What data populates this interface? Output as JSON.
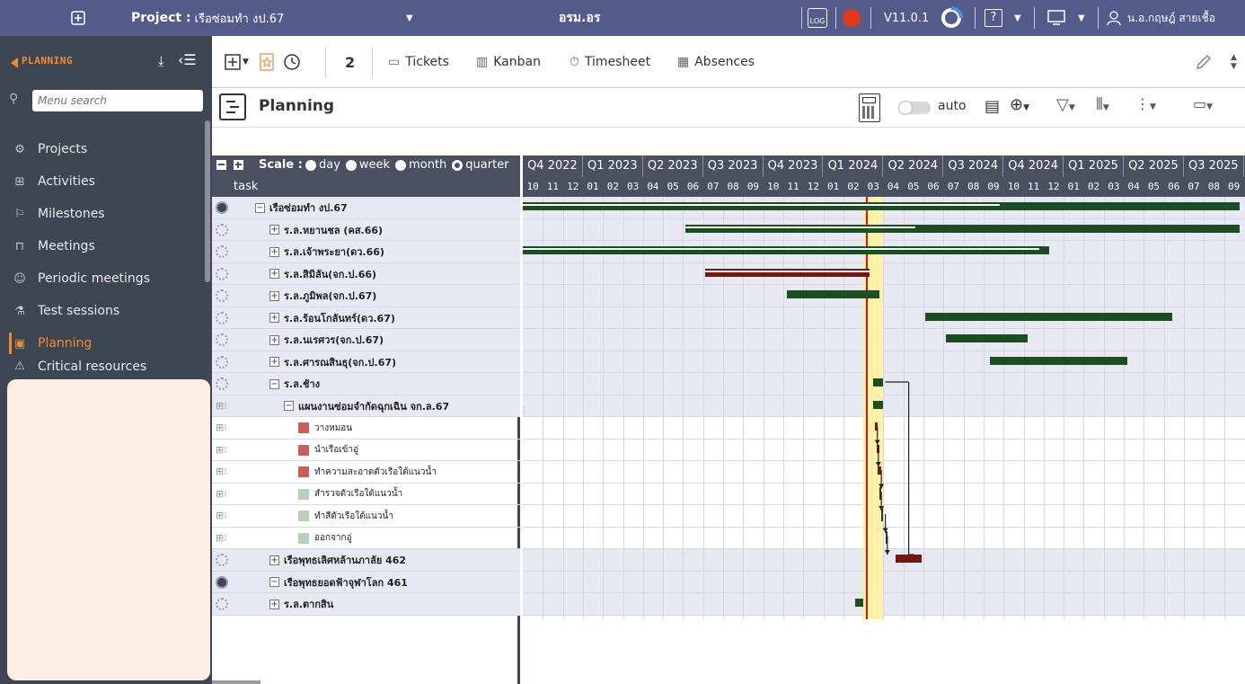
{
  "topbar": {
    "project_label": "Project :",
    "project_value": "เรือซ่อมทำ งป.67",
    "org": "อรม.อร",
    "log_label": "LOG",
    "version": "V11.0.1",
    "help_label": "?",
    "user": "น.อ.กฤษฎ์ สายเชื้อ"
  },
  "sidebar": {
    "title": "PLANNING",
    "search_placeholder": "Menu search",
    "items": [
      {
        "label": "Projects",
        "icon": "gear-icon"
      },
      {
        "label": "Activities",
        "icon": "hierarchy-icon"
      },
      {
        "label": "Milestones",
        "icon": "flag-icon"
      },
      {
        "label": "Meetings",
        "icon": "meeting-icon"
      },
      {
        "label": "Periodic meetings",
        "icon": "group-icon"
      },
      {
        "label": "Test sessions",
        "icon": "flask-icon"
      },
      {
        "label": "Planning",
        "icon": "planning-icon",
        "active": true
      },
      {
        "label": "Critical resources",
        "icon": "warning-icon"
      }
    ]
  },
  "toolbar": {
    "count": "2",
    "tickets": "Tickets",
    "kanban": "Kanban",
    "timesheet": "Timesheet",
    "absences": "Absences"
  },
  "planning": {
    "title": "Planning",
    "auto_label": "auto",
    "scale_label": "Scale :",
    "scale_options": [
      "day",
      "week",
      "month",
      "quarter"
    ],
    "scale_selected": "quarter",
    "task_header": "task"
  },
  "quarters": [
    "Q4 2022",
    "Q1 2023",
    "Q2 2023",
    "Q3 2023",
    "Q4 2023",
    "Q1 2024",
    "Q2 2024",
    "Q3 2024",
    "Q4 2024",
    "Q1 2025",
    "Q2 2025",
    "Q3 2025"
  ],
  "months": [
    "10",
    "11",
    "12",
    "01",
    "02",
    "03",
    "04",
    "05",
    "06",
    "07",
    "08",
    "09",
    "10",
    "11",
    "12",
    "01",
    "02",
    "03",
    "04",
    "05",
    "06",
    "07",
    "08",
    "09",
    "10",
    "11",
    "12",
    "01",
    "02",
    "03",
    "04",
    "05",
    "06",
    "07",
    "08",
    "09"
  ],
  "today_month_index": 17,
  "tasks": [
    {
      "name": "เรือซ่อมทำ งป.67",
      "level": 0,
      "exp": "−",
      "kind": "gear-sel",
      "grey": true,
      "bar": {
        "type": "g",
        "start": 0,
        "end": 35.8,
        "done": 23.8
      }
    },
    {
      "name": "ร.ล.หยานชล (คส.66)",
      "level": 1,
      "exp": "+",
      "kind": "gear",
      "grey": true,
      "bar": {
        "type": "g",
        "start": 8.1,
        "end": 35.8,
        "done": 19.6
      }
    },
    {
      "name": "ร.ล.เจ้าพระยา(ดว.66)",
      "level": 1,
      "exp": "+",
      "kind": "gear",
      "grey": true,
      "bar": {
        "type": "g",
        "start": 0,
        "end": 26.3,
        "done": 25.8
      }
    },
    {
      "name": "ร.ล.สิมิลัน(จก.ป.66)",
      "level": 1,
      "exp": "+",
      "kind": "gear",
      "grey": true,
      "bar": {
        "type": "r",
        "start": 9.1,
        "end": 17.3,
        "done": 17.3
      }
    },
    {
      "name": "ร.ล.ภูมิพล(จก.ป.67)",
      "level": 1,
      "exp": "+",
      "kind": "gear",
      "grey": true,
      "bar": {
        "type": "g",
        "start": 13.2,
        "end": 17.8,
        "done": 0
      }
    },
    {
      "name": "ร.ล.ร้อนโกลันทร์(ดว.67)",
      "level": 1,
      "exp": "+",
      "kind": "gear",
      "grey": true,
      "bar": {
        "type": "g",
        "start": 20.1,
        "end": 32.4,
        "done": 0
      }
    },
    {
      "name": "ร.ล.นเรศวร(จก.ป.67)",
      "level": 1,
      "exp": "+",
      "kind": "gear",
      "grey": true,
      "bar": {
        "type": "g",
        "start": 21.1,
        "end": 25.2,
        "done": 0
      }
    },
    {
      "name": "ร.ล.ศารณสินธุ(จก.ป.67)",
      "level": 1,
      "exp": "+",
      "kind": "gear",
      "grey": true,
      "bar": {
        "type": "g",
        "start": 23.3,
        "end": 30.2,
        "done": 0
      }
    },
    {
      "name": "ร.ล.ช้าง",
      "level": 1,
      "exp": "−",
      "kind": "gear",
      "grey": true,
      "bar": {
        "type": "g",
        "start": 17.5,
        "end": 18.0,
        "done": 0
      }
    },
    {
      "name": "แผนงานซ่อมจำกัดฉุกเฉิน จก.ล.67",
      "level": 2,
      "exp": "−",
      "kind": "act",
      "grey": true,
      "bar": {
        "type": "g",
        "start": 17.5,
        "end": 18.0,
        "done": 0
      }
    },
    {
      "name": "วางหมอน",
      "level": 3,
      "exp": "",
      "kind": "act",
      "grey": false,
      "sq": "#cc5b5b",
      "bar": {
        "type": "r",
        "start": 17.6,
        "end": 17.7,
        "done": 0
      }
    },
    {
      "name": "นำเรือเข้าอู่",
      "level": 3,
      "exp": "",
      "kind": "act",
      "grey": false,
      "sq": "#cc5b5b",
      "bar": {
        "type": "r",
        "start": 17.65,
        "end": 17.75,
        "done": 0
      }
    },
    {
      "name": "ทำความสะอาดตัวเรือใต้แนวน้ำ",
      "level": 3,
      "exp": "",
      "kind": "act",
      "grey": false,
      "sq": "#cc5b5b",
      "bar": {
        "type": "r",
        "start": 17.7,
        "end": 17.9,
        "done": 0
      }
    },
    {
      "name": "สำรวจตัวเรือใต้แนวน้ำ",
      "level": 3,
      "exp": "",
      "kind": "act",
      "grey": false,
      "sq": "#b8d0b8",
      "bar": {
        "type": "n",
        "start": 17.8,
        "end": 17.9,
        "done": 0
      }
    },
    {
      "name": "ทำสีตัวเรือใต้แนวน้ำ",
      "level": 3,
      "exp": "",
      "kind": "act",
      "grey": false,
      "sq": "#b8d0b8",
      "bar": {
        "type": "n",
        "start": 17.9,
        "end": 18.1,
        "done": 0
      }
    },
    {
      "name": "ออกจากอู่",
      "level": 3,
      "exp": "",
      "kind": "act",
      "grey": false,
      "sq": "#b8d0b8",
      "bar": {
        "type": "n",
        "start": 18.1,
        "end": 18.2,
        "done": 0
      }
    },
    {
      "name": "เรือพุทธเลิศหล้านภาลัย 462",
      "level": 1,
      "exp": "+",
      "kind": "gear",
      "grey": true,
      "bar": {
        "type": "r",
        "start": 18.6,
        "end": 19.9,
        "done": 0
      }
    },
    {
      "name": "เรือพุทธยอดฟ้าจุฬาโลก 461",
      "level": 1,
      "exp": "−",
      "kind": "gear-sel",
      "grey": true,
      "bar": {
        "type": "n",
        "start": 0,
        "end": 0,
        "done": 0
      }
    },
    {
      "name": "ร.ล.ตากสิน",
      "level": 1,
      "exp": "+",
      "kind": "gear",
      "grey": true,
      "bar": {
        "type": "g",
        "start": 16.6,
        "end": 17.0,
        "done": 0
      }
    }
  ]
}
